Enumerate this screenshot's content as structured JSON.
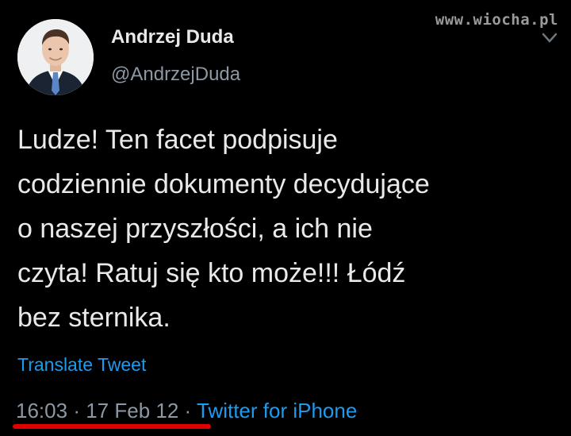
{
  "watermark": {
    "text": "www.wiocha.pl"
  },
  "author": {
    "name": "Andrzej Duda",
    "handle": "@AndrzejDuda",
    "avatar_icon": "profile-photo"
  },
  "tweet": {
    "lines": [
      "Ludze! Ten facet podpisuje",
      "codziennie dokumenty decydujące",
      "o naszej przyszłości, a ich nie",
      "czyta! Ratuj się kto może!!! Łódź",
      "bez sternika."
    ],
    "translate_label": "Translate Tweet",
    "time": "16:03",
    "separator": "·",
    "date": "17 Feb 12",
    "source": "Twitter for iPhone"
  },
  "icons": {
    "more": "chevron-down-icon"
  },
  "colors": {
    "background": "#000000",
    "text": "#e7e9ea",
    "secondary": "#8b98a5",
    "link": "#1d9bf0",
    "highlight": "#e00000"
  }
}
